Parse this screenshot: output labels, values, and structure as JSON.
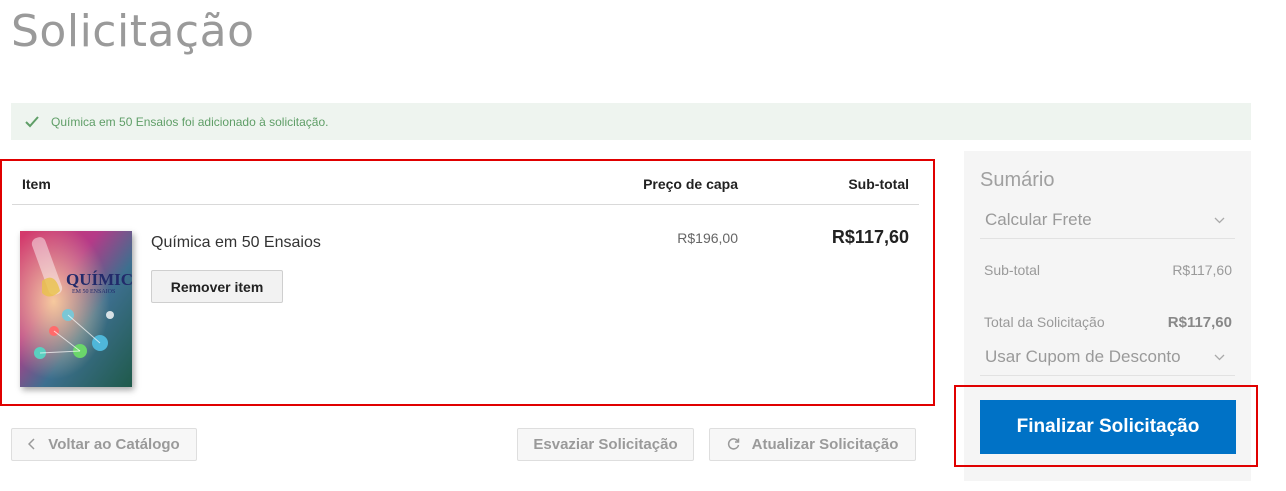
{
  "page": {
    "title": "Solicitação"
  },
  "alert": {
    "message": "Química em 50 Ensaios foi adicionado à solicitação."
  },
  "cart": {
    "headers": {
      "item": "Item",
      "price": "Preço de capa",
      "subtotal": "Sub-total"
    },
    "items": [
      {
        "name": "Química em 50 Ensaios",
        "cover_title": "QUÍMICA",
        "cover_subtitle": "EM 50 ENSAIOS",
        "price": "R$196,00",
        "subtotal": "R$117,60",
        "remove_label": "Remover item"
      }
    ]
  },
  "actions": {
    "back_label": "Voltar ao Catálogo",
    "empty_label": "Esvaziar Solicitação",
    "update_label": "Atualizar Solicitação"
  },
  "summary": {
    "title": "Sumário",
    "shipping_label": "Calcular Frete",
    "subtotal_label": "Sub-total",
    "subtotal_value": "R$117,60",
    "total_label": "Total da Solicitação",
    "total_value": "R$117,60",
    "coupon_label": "Usar Cupom de Desconto",
    "checkout_label": "Finalizar Solicitação"
  },
  "colors": {
    "accent": "#0072c6",
    "highlight_border": "#e00000",
    "alert_bg": "#eef4ef",
    "alert_text": "#5f9e67"
  },
  "icons": {
    "alert": "check-icon",
    "back": "chevron-left-icon",
    "update": "refresh-icon",
    "dropdown": "chevron-down-icon"
  }
}
